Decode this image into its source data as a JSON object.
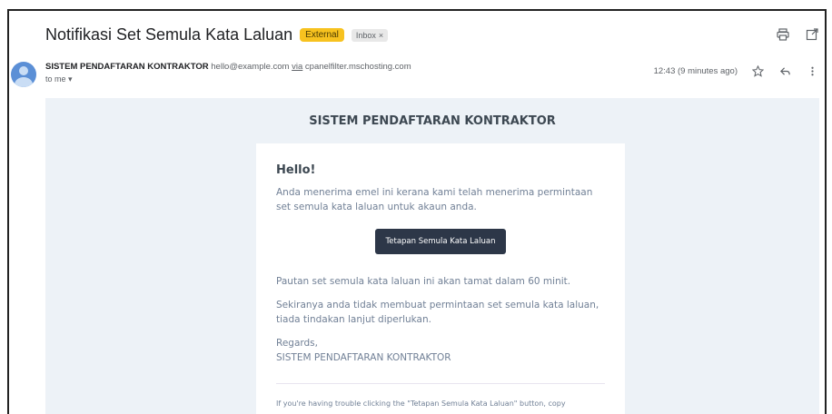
{
  "header": {
    "subject": "Notifikasi Set Semula Kata Laluan",
    "badge_external": "External",
    "badge_inbox": "Inbox",
    "badge_inbox_close": "×"
  },
  "sender": {
    "name": "SISTEM PENDAFTARAN KONTRAKTOR",
    "email": "hello@example.com",
    "via_label": "via",
    "via_domain": "cpanelfilter.mschosting.com",
    "to": "to me",
    "time": "12:43 (9 minutes ago)"
  },
  "icons": {
    "print": "print-icon",
    "open": "open-in-new-icon",
    "star": "star-icon",
    "reply": "reply-icon",
    "more": "more-vert-icon",
    "dropdown": "chevron-down-icon"
  },
  "email": {
    "brand": "SISTEM PENDAFTARAN KONTRAKTOR",
    "greeting": "Hello!",
    "line1": "Anda menerima emel ini kerana kami telah menerima permintaan set semula kata laluan untuk akaun anda.",
    "button": "Tetapan Semula Kata Laluan",
    "line2": "Pautan set semula kata laluan ini akan tamat dalam 60 minit.",
    "line3": "Sekiranya anda tidak membuat permintaan set semula kata laluan, tiada tindakan lanjut diperlukan.",
    "regards": "Regards,",
    "signature": "SISTEM PENDAFTARAN KONTRAKTOR",
    "footer_partial": "If you're having trouble clicking the \"Tetapan Semula Kata Laluan\" button, copy"
  }
}
